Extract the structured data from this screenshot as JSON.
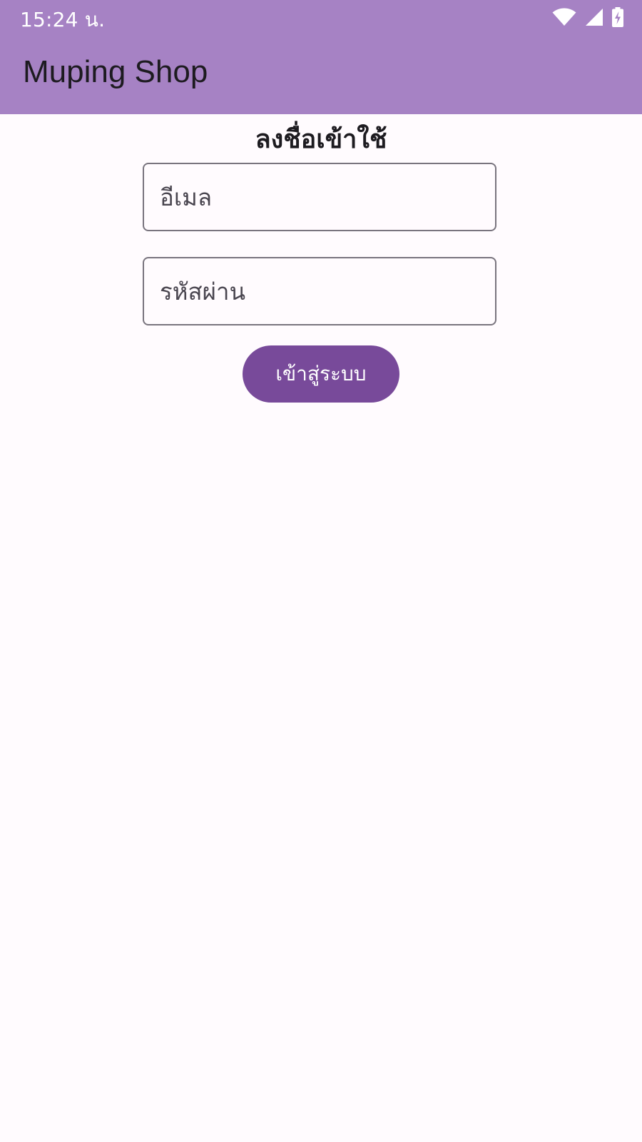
{
  "status_bar": {
    "time": "15:24 น.",
    "icons": [
      "wifi-icon",
      "cell-signal-icon",
      "battery-charging-icon"
    ]
  },
  "app_bar": {
    "title": "Muping Shop",
    "background_color": "#a682c4"
  },
  "login": {
    "heading": "ลงชื่อเข้าใช้",
    "email": {
      "placeholder": "อีเมล",
      "value": ""
    },
    "password": {
      "placeholder": "รหัสผ่าน",
      "value": ""
    },
    "submit_label": "เข้าสู่ระบบ",
    "button_color": "#784a9a"
  }
}
